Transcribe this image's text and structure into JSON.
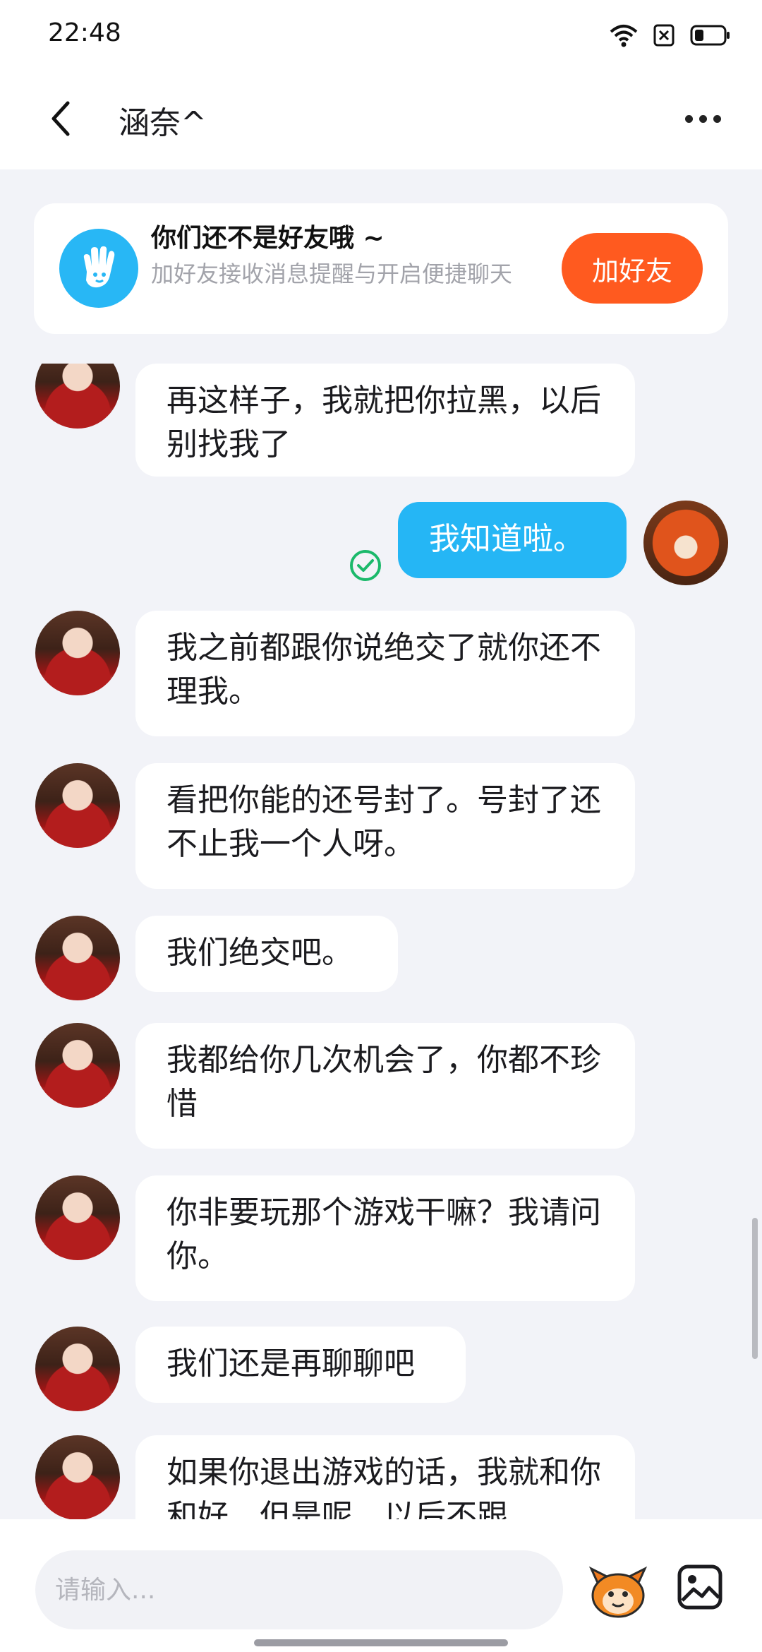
{
  "status_bar": {
    "time": "22:48",
    "icons": [
      "wifi-icon",
      "sim-blocked-icon",
      "battery-icon"
    ]
  },
  "header": {
    "title": "涵奈^",
    "back_icon": "chevron-left-icon",
    "more_icon": "more-horizontal-icon"
  },
  "friend_banner": {
    "icon": "waving-hand-icon",
    "title": "你们还不是好友哦 ~",
    "description": "加好友接收消息提醒与开启便捷聊天",
    "button_label": "加好友",
    "button_color": "#ff5a1f"
  },
  "messages": [
    {
      "direction": "incoming",
      "text": "再这样子，我就把你拉黑，以后别找我了"
    },
    {
      "direction": "outgoing",
      "text": "我知道啦。",
      "status": "read"
    },
    {
      "direction": "incoming",
      "text": "我之前都跟你说绝交了就你还不理我。"
    },
    {
      "direction": "incoming",
      "text": "看把你能的还号封了。号封了还不止我一个人呀。"
    },
    {
      "direction": "incoming",
      "text": "我们绝交吧。"
    },
    {
      "direction": "incoming",
      "text": "我都给你几次机会了，你都不珍惜"
    },
    {
      "direction": "incoming",
      "text": "你非要玩那个游戏干嘛？我请问你。"
    },
    {
      "direction": "incoming",
      "text": "我们还是再聊聊吧"
    },
    {
      "direction": "incoming",
      "text": "如果你退出游戏的话，我就和你和好，但是呢，以后不跟"
    }
  ],
  "input_bar": {
    "placeholder": "请输入...",
    "emoji_icon": "mascot-emoji-icon",
    "image_icon": "image-icon"
  },
  "colors": {
    "outgoing_bubble": "#25b6f5",
    "incoming_bubble": "#ffffff",
    "chat_background": "#f2f3f8",
    "read_check": "#1bb96b"
  }
}
